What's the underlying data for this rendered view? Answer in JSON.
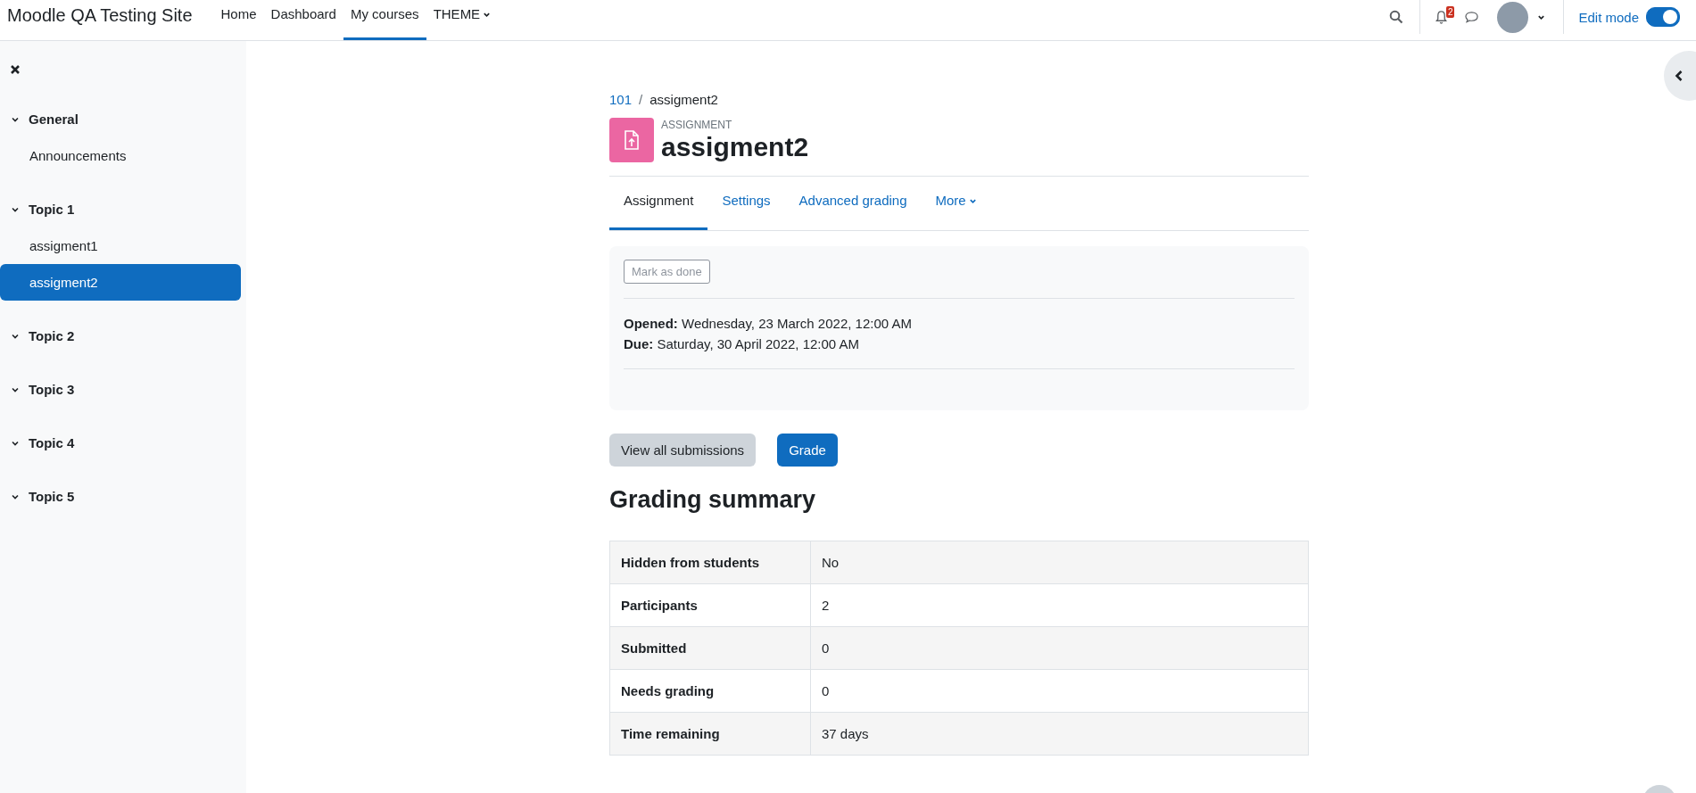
{
  "site_name": "Moodle QA Testing Site",
  "nav": [
    {
      "label": "Home",
      "selected": false,
      "dropdown": false
    },
    {
      "label": "Dashboard",
      "selected": false,
      "dropdown": false
    },
    {
      "label": "My courses",
      "selected": true,
      "dropdown": false
    },
    {
      "label": "THEME",
      "selected": false,
      "dropdown": true
    }
  ],
  "notifications": {
    "count": "2"
  },
  "edit_mode": {
    "label": "Edit mode",
    "on": true
  },
  "sidebar": {
    "sections": [
      {
        "title": "General",
        "expanded": true,
        "items": [
          {
            "label": "Announcements",
            "selected": false
          }
        ]
      },
      {
        "title": "Topic 1",
        "expanded": true,
        "items": [
          {
            "label": "assigment1",
            "selected": false
          },
          {
            "label": "assigment2",
            "selected": true
          }
        ]
      },
      {
        "title": "Topic 2",
        "expanded": true
      },
      {
        "title": "Topic 3",
        "expanded": true
      },
      {
        "title": "Topic 4",
        "expanded": true
      },
      {
        "title": "Topic 5",
        "expanded": true
      }
    ]
  },
  "breadcrumb": {
    "separator": "/",
    "items": [
      "101",
      "assigment2"
    ]
  },
  "activity": {
    "type_label": "ASSIGNMENT",
    "title": "assigment2"
  },
  "tabs": [
    {
      "label": "Assignment",
      "selected": true,
      "dropdown": false
    },
    {
      "label": "Settings",
      "selected": false,
      "dropdown": false
    },
    {
      "label": "Advanced grading",
      "selected": false,
      "dropdown": false
    },
    {
      "label": "More",
      "selected": false,
      "dropdown": true
    }
  ],
  "completion": {
    "button": "Mark as done"
  },
  "dates": [
    {
      "label": "Opened:",
      "value": "Wednesday, 23 March 2022, 12:00 AM"
    },
    {
      "label": "Due:",
      "value": "Saturday, 30 April 2022, 12:00 AM"
    }
  ],
  "buttons": [
    {
      "label": "View all submissions",
      "kind": "secondary"
    },
    {
      "label": "Grade",
      "kind": "primary"
    }
  ],
  "grading_summary": {
    "heading": "Grading summary",
    "rows": [
      {
        "label": "Hidden from students",
        "value": "No"
      },
      {
        "label": "Participants",
        "value": "2"
      },
      {
        "label": "Submitted",
        "value": "0"
      },
      {
        "label": "Needs grading",
        "value": "0"
      },
      {
        "label": "Time remaining",
        "value": "37 days"
      }
    ]
  }
}
